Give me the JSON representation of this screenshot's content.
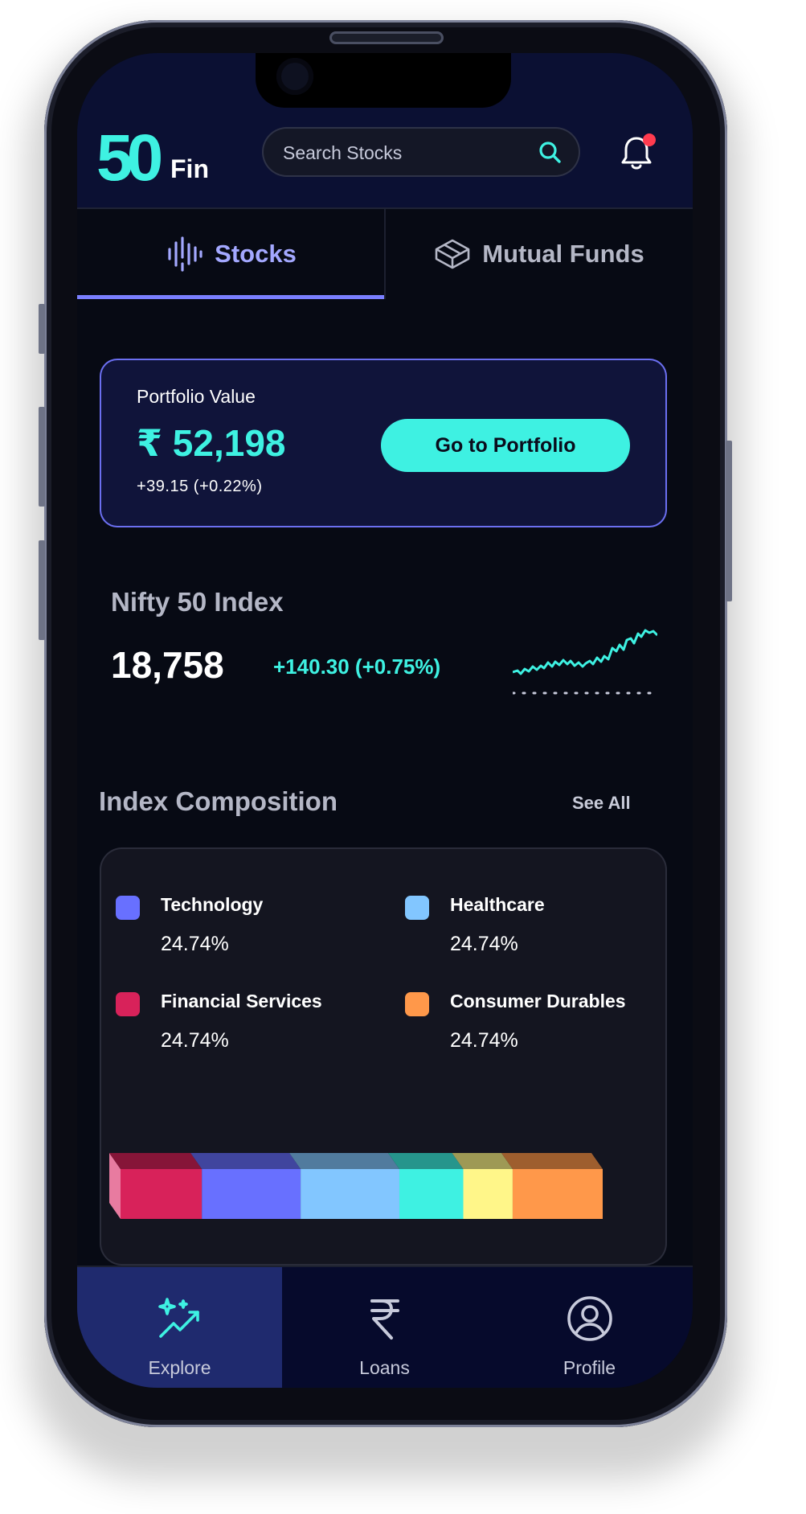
{
  "app": {
    "logo_number": "50",
    "logo_text": "Fin",
    "brand_color": "#3ef1e2",
    "accent_color": "#7a7fff"
  },
  "header": {
    "search_placeholder": "Search Stocks",
    "search_icon": "search-icon",
    "notification_icon": "bell-icon",
    "has_unread_notification": true
  },
  "tabs": [
    {
      "label": "Stocks",
      "icon": "waveform-icon",
      "active": true
    },
    {
      "label": "Mutual Funds",
      "icon": "cube-icon",
      "active": false
    }
  ],
  "portfolio": {
    "title": "Portfolio Value",
    "value": "₹ 52,198",
    "change": "+39.15 (+0.22%)",
    "button_label": "Go to Portfolio"
  },
  "nifty": {
    "title": "Nifty 50 Index",
    "value": "18,758",
    "change": "+140.30 (+0.75%)",
    "sparkline_icon": "sparkline-chart"
  },
  "index_composition": {
    "title": "Index Composition",
    "see_all_label": "See All",
    "legend": [
      {
        "name": "Technology",
        "percent": "24.74%",
        "color": "#6870ff"
      },
      {
        "name": "Healthcare",
        "percent": "24.74%",
        "color": "#82c6ff"
      },
      {
        "name": "Financial Services",
        "percent": "24.74%",
        "color": "#d8225a"
      },
      {
        "name": "Consumer Durables",
        "percent": "24.74%",
        "color": "#ff984a"
      }
    ],
    "bar_segments": [
      {
        "color": "#d8225a",
        "fraction": 0.14
      },
      {
        "color": "#6870ff",
        "fraction": 0.17
      },
      {
        "color": "#82c6ff",
        "fraction": 0.17
      },
      {
        "color": "#3ef1e2",
        "fraction": 0.11
      },
      {
        "color": "#fff689",
        "fraction": 0.085
      },
      {
        "color": "#ff984a",
        "fraction": 0.155
      }
    ]
  },
  "bottom_nav": [
    {
      "label": "Explore",
      "icon": "sparkle-chart-icon",
      "active": true
    },
    {
      "label": "Loans",
      "icon": "rupee-icon",
      "active": false
    },
    {
      "label": "Profile",
      "icon": "user-circle-icon",
      "active": false
    }
  ]
}
